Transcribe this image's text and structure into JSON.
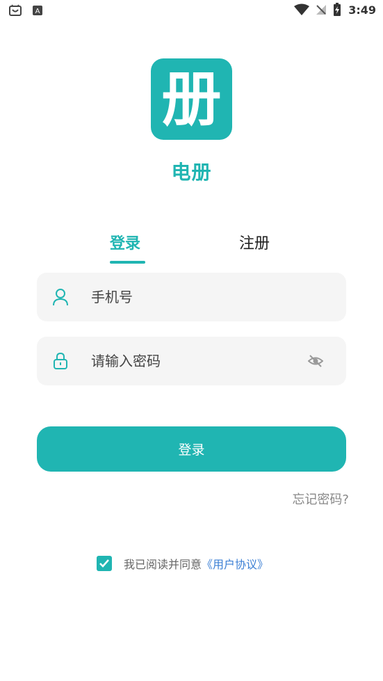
{
  "status_bar": {
    "time": "3:49"
  },
  "app": {
    "logo_glyph": "册",
    "name": "电册"
  },
  "tabs": {
    "login": "登录",
    "register": "注册"
  },
  "form": {
    "phone_placeholder": "手机号",
    "password_placeholder": "请输入密码",
    "login_button": "登录",
    "forgot_password": "忘记密码?"
  },
  "agreement": {
    "checked": true,
    "text": "我已阅读并同意",
    "link": "《用户协议》"
  },
  "colors": {
    "accent": "#20b5b2",
    "link": "#3b7fd4",
    "field_bg": "#f5f5f5"
  }
}
